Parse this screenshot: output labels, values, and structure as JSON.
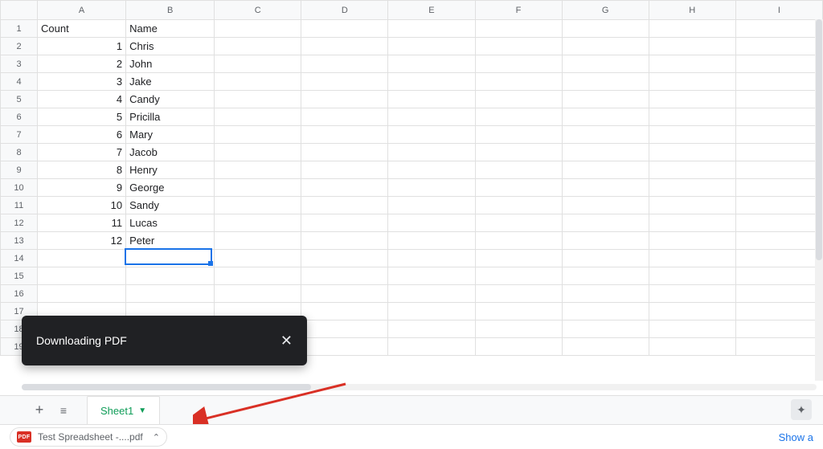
{
  "columns": [
    "A",
    "B",
    "C",
    "D",
    "E",
    "F",
    "G",
    "H",
    "I"
  ],
  "header_row": {
    "A": "Count",
    "B": "Name"
  },
  "data_rows": [
    {
      "A": "1",
      "B": "Chris"
    },
    {
      "A": "2",
      "B": "John"
    },
    {
      "A": "3",
      "B": "Jake"
    },
    {
      "A": "4",
      "B": "Candy"
    },
    {
      "A": "5",
      "B": "Pricilla"
    },
    {
      "A": "6",
      "B": "Mary"
    },
    {
      "A": "7",
      "B": "Jacob"
    },
    {
      "A": "8",
      "B": "Henry"
    },
    {
      "A": "9",
      "B": "George"
    },
    {
      "A": "10",
      "B": "Sandy"
    },
    {
      "A": "11",
      "B": "Lucas"
    },
    {
      "A": "12",
      "B": "Peter"
    }
  ],
  "total_visible_rows": 19,
  "selected_cell": "B14",
  "toast": {
    "message": "Downloading PDF",
    "close_glyph": "✕"
  },
  "tabbar": {
    "add_glyph": "+",
    "all_glyph": "≡",
    "sheet_label": "Sheet1",
    "caret_glyph": "▼",
    "explore_glyph": "✦"
  },
  "download": {
    "badge_text": "PDF",
    "filename": "Test Spreadsheet -....pdf",
    "chevron_glyph": "⌃",
    "show_all_label": "Show a"
  }
}
